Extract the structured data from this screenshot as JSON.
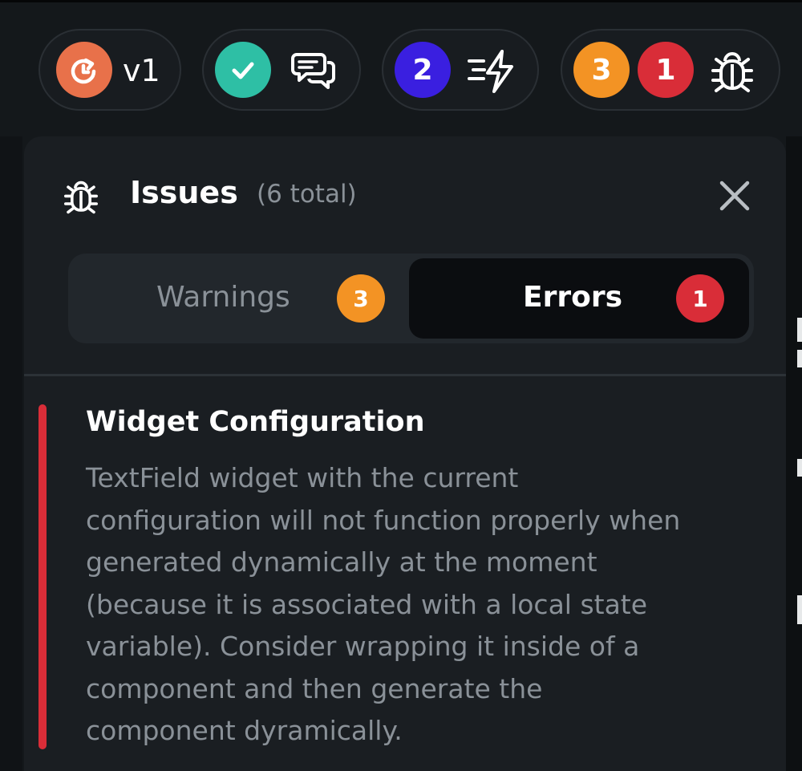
{
  "toolbar": {
    "version_label": "v1",
    "tasks_count": "2",
    "warnings_count": "3",
    "errors_count": "1"
  },
  "issues_panel": {
    "title": "Issues",
    "total": "(6 total)",
    "tabs": [
      {
        "label": "Warnings",
        "count": "3"
      },
      {
        "label": "Errors",
        "count": "1"
      }
    ],
    "active_tab": "Errors",
    "issues": [
      {
        "title": "Widget Configuration",
        "description": "TextField widget with the current\nconfiguration will not function properly when\ngenerated dynamically at the moment\n(because it is associated with a local state\nvariable). Consider wrapping it inside of a\ncomponent and then generate the\ncomponent dyramically."
      }
    ]
  },
  "colors": {
    "background": "#14181b",
    "panel": "#1a1e22",
    "version": "#e8714a",
    "success": "#2ebfa5",
    "tasks": "#3a1fe0",
    "warning": "#f39324",
    "error": "#d92d38",
    "text_primary": "#ffffff",
    "text_secondary": "#8a9198"
  },
  "icons": {
    "version": "refresh-clock-icon",
    "status": "check-icon",
    "comments": "chat-bubbles-icon",
    "tasks": "fast-lightning-icon",
    "debug": "bug-icon",
    "close": "close-icon"
  }
}
